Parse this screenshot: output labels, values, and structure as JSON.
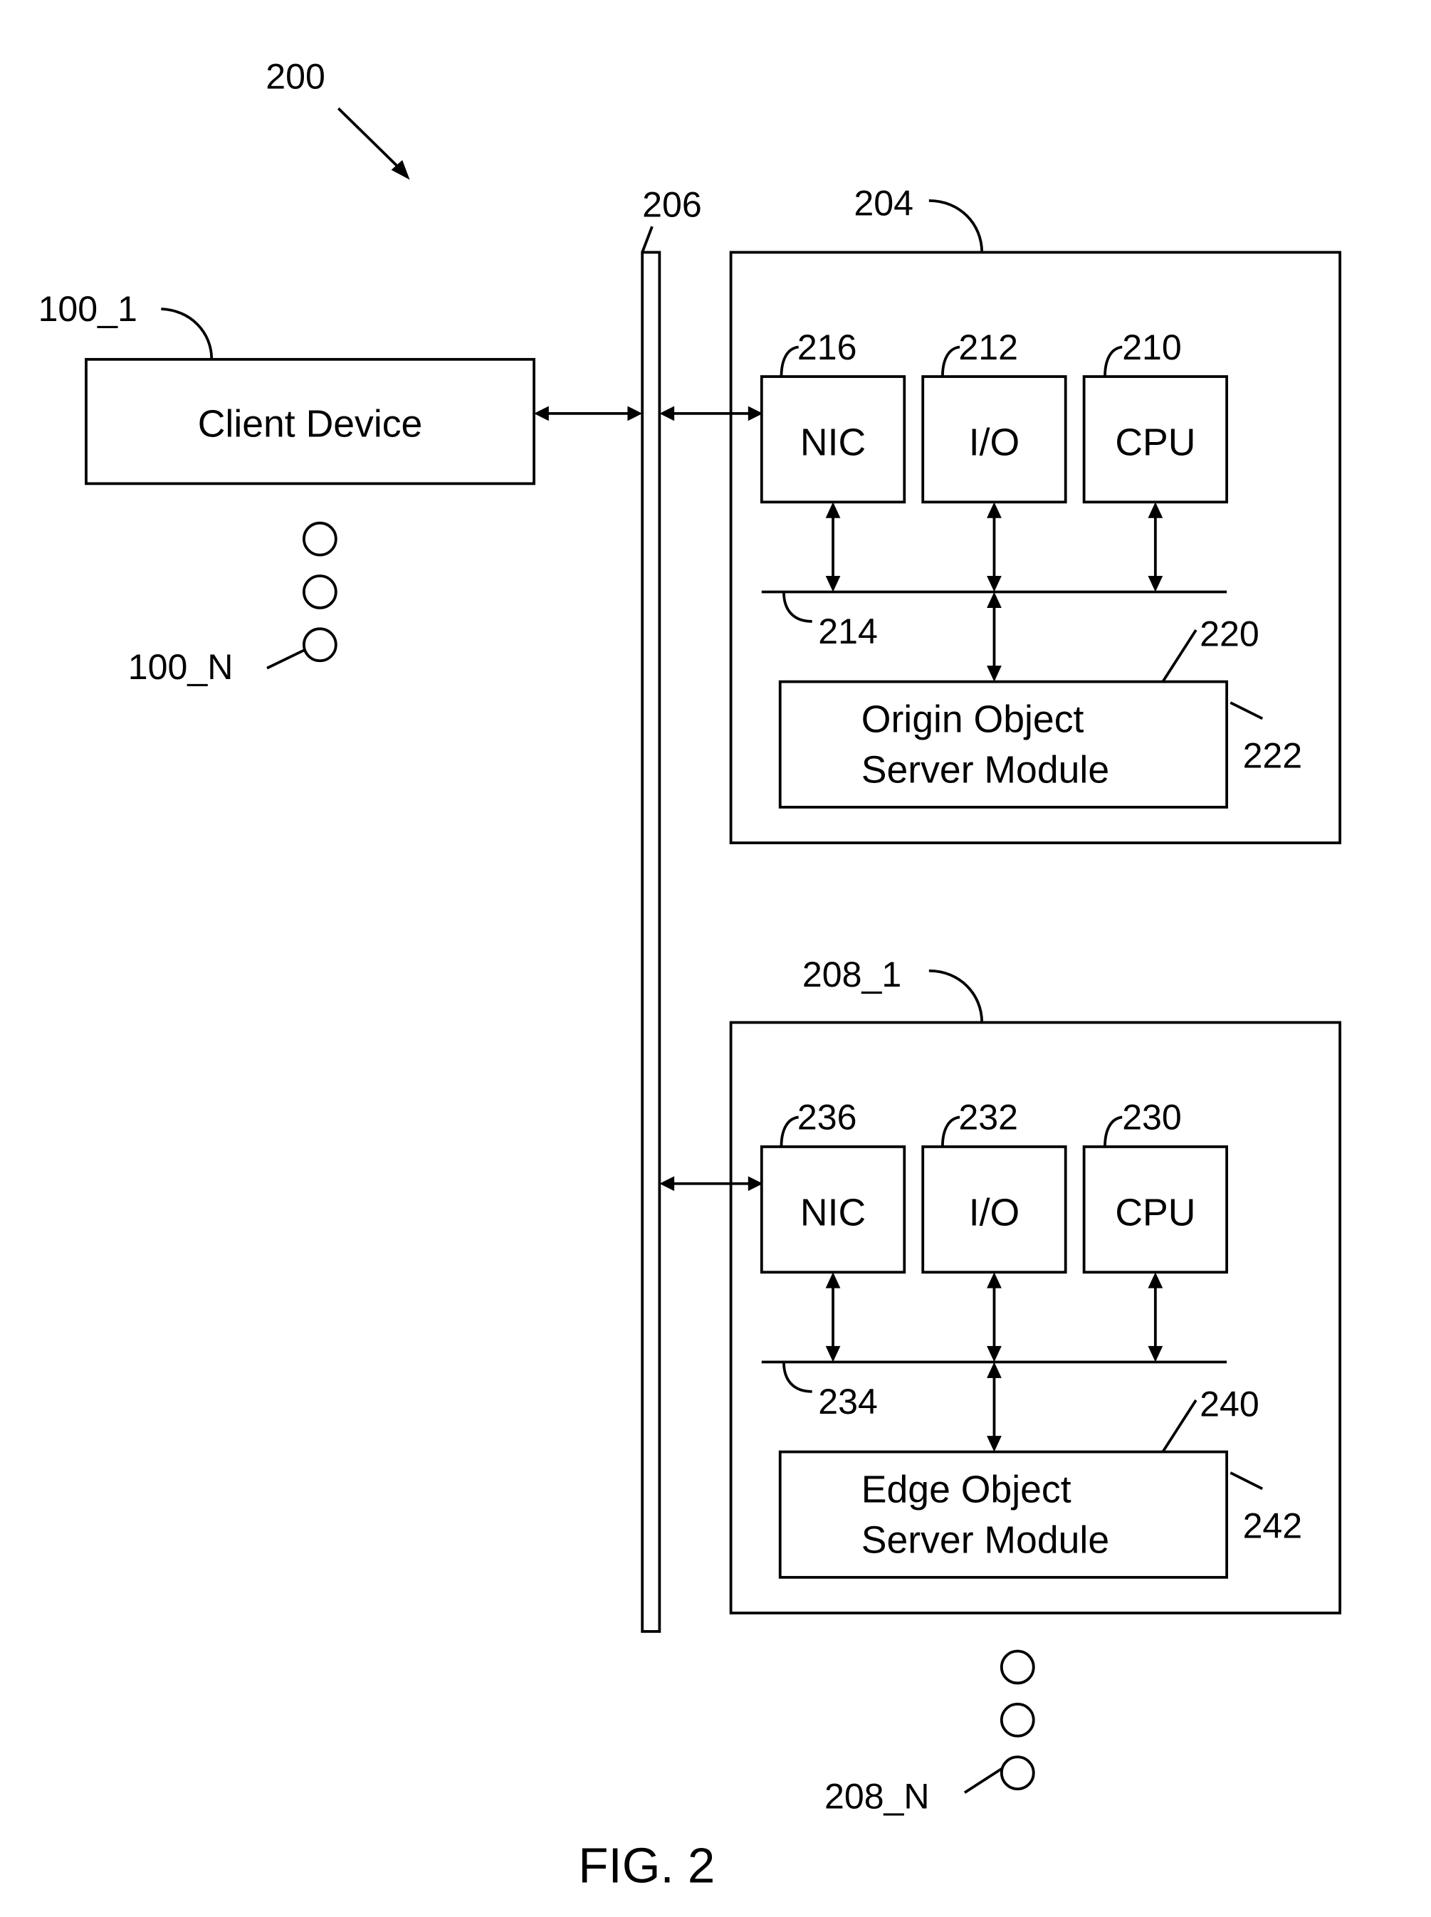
{
  "figure": {
    "caption": "FIG. 2",
    "system_ref": "200",
    "network_ref": "206",
    "colors": {
      "stroke": "#000000",
      "background": "#ffffff"
    }
  },
  "client": {
    "ref_first": "100_1",
    "ref_last": "100_N",
    "label": "Client Device"
  },
  "origin_server": {
    "ref": "204",
    "nic": {
      "label": "NIC",
      "ref": "216"
    },
    "io": {
      "label": "I/O",
      "ref": "212"
    },
    "cpu": {
      "label": "CPU",
      "ref": "210"
    },
    "bus_ref": "214",
    "module": {
      "line1": "Origin Object",
      "line2": "Server Module",
      "ref": "220",
      "sub_ref": "222"
    }
  },
  "edge_server": {
    "ref_first": "208_1",
    "ref_last": "208_N",
    "nic": {
      "label": "NIC",
      "ref": "236"
    },
    "io": {
      "label": "I/O",
      "ref": "232"
    },
    "cpu": {
      "label": "CPU",
      "ref": "230"
    },
    "bus_ref": "234",
    "module": {
      "line1": "Edge Object",
      "line2": "Server Module",
      "ref": "240",
      "sub_ref": "242"
    }
  }
}
